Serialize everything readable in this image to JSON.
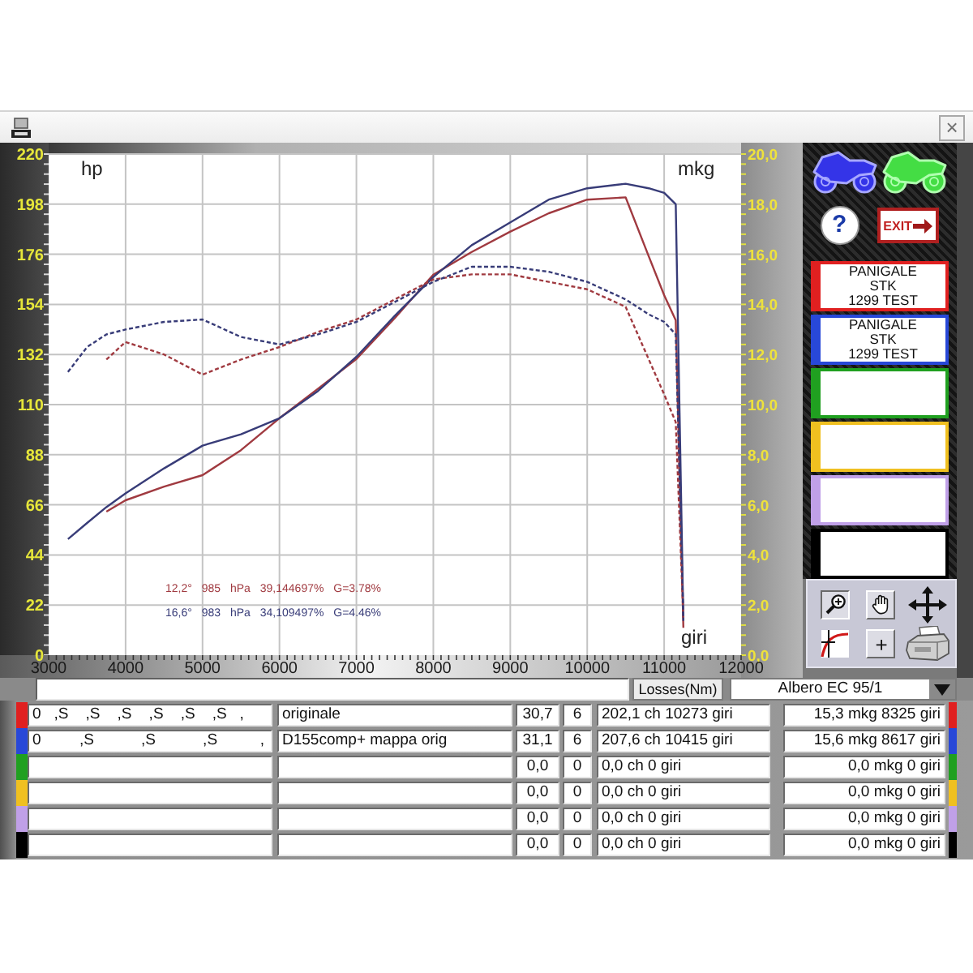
{
  "title_bar": {
    "close_button": "×"
  },
  "chart": {
    "chart_data": {
      "type": "line",
      "xlabel": "giri",
      "ylabel": "hp",
      "y2label": "mkg",
      "x": [
        3250,
        3500,
        3750,
        4000,
        4500,
        5000,
        5500,
        6000,
        6500,
        7000,
        7500,
        8000,
        8500,
        9000,
        9500,
        10000,
        10500,
        10800,
        11000,
        11150,
        11250
      ],
      "xlim": [
        3000,
        12000
      ],
      "ylim": [
        0,
        220
      ],
      "y2lim": [
        0,
        20
      ],
      "xticks": [
        3000,
        4000,
        5000,
        6000,
        7000,
        8000,
        9000,
        10000,
        11000,
        12000
      ],
      "yticks": [
        0,
        22,
        44,
        66,
        88,
        110,
        132,
        154,
        176,
        198,
        220
      ],
      "y2ticks": [
        {
          "value": 0,
          "label": "0,0"
        },
        {
          "value": 2,
          "label": "2,0"
        },
        {
          "value": 4,
          "label": "4,0"
        },
        {
          "value": 6,
          "label": "6,0"
        },
        {
          "value": 8,
          "label": "8,0"
        },
        {
          "value": 10,
          "label": "10,0"
        },
        {
          "value": 12,
          "label": "12,0"
        },
        {
          "value": 14,
          "label": "14,0"
        },
        {
          "value": 16,
          "label": "16,0"
        },
        {
          "value": 18,
          "label": "18,0"
        },
        {
          "value": 20,
          "label": "20,0"
        }
      ],
      "grid": true,
      "series": [
        {
          "color": "#a03a40",
          "values": [
            null,
            null,
            63,
            68,
            74,
            79,
            90,
            104,
            117,
            130,
            148,
            167,
            177,
            186,
            194,
            200,
            201,
            175,
            158,
            147,
            12
          ]
        },
        {
          "color": "#383c78",
          "values": [
            51,
            58,
            65,
            71,
            82,
            92,
            97,
            104,
            116,
            131,
            149,
            166,
            180,
            190,
            200,
            205,
            207,
            205,
            203,
            198,
            15
          ]
        },
        {
          "color": "#a03a40",
          "axis": "y2",
          "line_style": "dashed",
          "values": [
            null,
            null,
            11.8,
            12.5,
            12.0,
            11.2,
            11.8,
            12.3,
            12.9,
            13.4,
            14.2,
            15.0,
            15.2,
            15.2,
            14.9,
            14.6,
            13.9,
            11.8,
            10.4,
            9.3,
            1.5
          ]
        },
        {
          "color": "#383c78",
          "axis": "y2",
          "line_style": "dashed",
          "values": [
            11.3,
            12.3,
            12.8,
            13.0,
            13.3,
            13.4,
            12.7,
            12.4,
            12.8,
            13.3,
            14.1,
            14.9,
            15.5,
            15.5,
            15.3,
            14.9,
            14.2,
            13.6,
            13.3,
            12.8,
            1.5
          ]
        }
      ],
      "annotations": [
        {
          "text": "12,2° 985 hPa 39,144697% G=3.78%"
        },
        {
          "text": "16,6° 983 hPa 34,109497% G=4.46%"
        }
      ]
    }
  },
  "panel": {
    "help_button": "?",
    "exit_button": "EXIT",
    "slots": [
      {
        "color": "#e02020",
        "lines": [
          "PANIGALE",
          "STK",
          "1299 TEST"
        ]
      },
      {
        "color": "#2848d8",
        "lines": [
          "PANIGALE",
          "STK",
          "1299 TEST"
        ]
      },
      {
        "color": "#20a020"
      },
      {
        "color": "#f0c020"
      },
      {
        "color": "#c0a0e8"
      },
      {
        "color": "#000000"
      }
    ],
    "plus_button": "+"
  },
  "controls": {
    "losses_button": "Losses(Nm)",
    "dropdown": "Albero EC 95/1"
  },
  "runs": [
    {
      "color": "#e02020",
      "column_1": "0   ,S    ,S    ,S    ,S    ,S    ,S   ,",
      "name": "originale",
      "column_3": "30,7",
      "column_4": "6",
      "max_power": "202,1 ch 10273 giri",
      "max_torque": "15,3 mkg 8325 giri"
    },
    {
      "color": "#2848d8",
      "column_1": "0         ,S           ,S           ,S          ,",
      "name": "D155comp+ mappa orig",
      "column_3": "31,1",
      "column_4": "6",
      "max_power": "207,6 ch 10415 giri",
      "max_torque": "15,6 mkg 8617 giri"
    },
    {
      "color": "#20a020",
      "column_3": "0,0",
      "column_4": "0",
      "max_power": "0,0 ch 0 giri",
      "max_torque": "0,0 mkg 0 giri"
    },
    {
      "color": "#f0c020",
      "column_3": "0,0",
      "column_4": "0",
      "max_power": "0,0 ch 0 giri",
      "max_torque": "0,0 mkg 0 giri"
    },
    {
      "color": "#c0a0e8",
      "column_3": "0,0",
      "column_4": "0",
      "max_power": "0,0 ch 0 giri",
      "max_torque": "0,0 mkg 0 giri"
    },
    {
      "color": "#000000",
      "column_3": "0,0",
      "column_4": "0",
      "max_power": "0,0 ch 0 giri",
      "max_torque": "0,0 mkg 0 giri"
    }
  ]
}
